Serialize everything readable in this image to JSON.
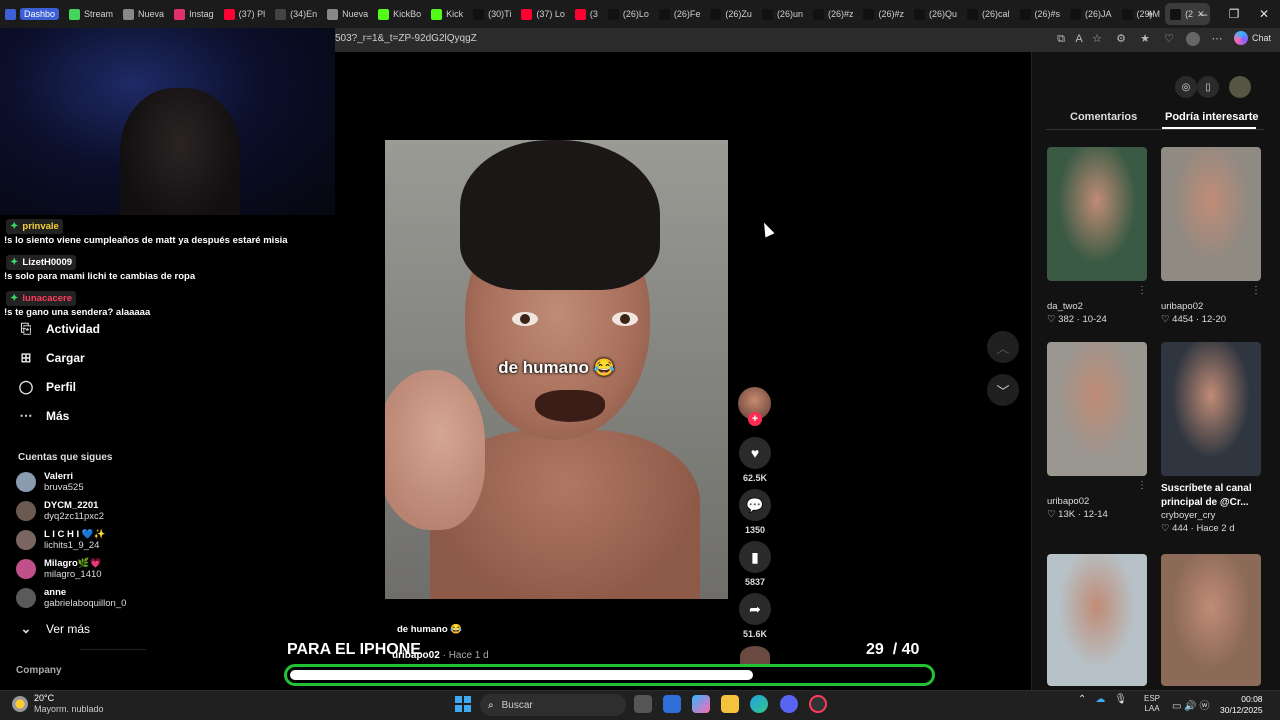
{
  "browser": {
    "tabs": [
      {
        "label": "Dashbo",
        "color": "#3d5fd6",
        "pill": true
      },
      {
        "label": "Stream",
        "color": "#46d35e"
      },
      {
        "label": "Nueva",
        "color": "#888888"
      },
      {
        "label": "Instag",
        "color": "#e1306c"
      },
      {
        "label": "(37) Pl",
        "color": "#ff0033"
      },
      {
        "label": "(34)En",
        "color": "#444444"
      },
      {
        "label": "Nueva",
        "color": "#888888"
      },
      {
        "label": "KickBo",
        "color": "#53fc18"
      },
      {
        "label": "Kick",
        "color": "#53fc18"
      },
      {
        "label": "(30)Ti",
        "color": "#111111"
      },
      {
        "label": "(37) Lo",
        "color": "#ff0033"
      },
      {
        "label": "(3",
        "color": "#ff0033"
      },
      {
        "label": "(26)Lo",
        "color": "#111111"
      },
      {
        "label": "(26)Fe",
        "color": "#111111"
      },
      {
        "label": "(26)Zu",
        "color": "#111111"
      },
      {
        "label": "(26)un",
        "color": "#111111"
      },
      {
        "label": "(26)#z",
        "color": "#111111"
      },
      {
        "label": "(26)#z",
        "color": "#111111"
      },
      {
        "label": "(26)Qu",
        "color": "#111111"
      },
      {
        "label": "(26)cal",
        "color": "#111111"
      },
      {
        "label": "(26)#s",
        "color": "#111111"
      },
      {
        "label": "(26)JA",
        "color": "#111111"
      },
      {
        "label": "(29)M",
        "color": "#111111"
      },
      {
        "label": "(2",
        "color": "#111111",
        "active": true
      }
    ],
    "url": "503?_r=1&_t=ZP-92dG2lQyqgZ",
    "chat_label": "Chat"
  },
  "chat": [
    {
      "user": "prinvale",
      "user_color": "#f5d23a",
      "message": "!s lo siento viene cumpleaños de matt ya después estaré misia"
    },
    {
      "user": "LizetH0009",
      "user_color": "#ffffff",
      "message": "!s solo para mami lichi te cambias de ropa"
    },
    {
      "user": "lunacacere",
      "user_color": "#ff3b5c",
      "message": "!s te gano una sendera? alaaaaa"
    }
  ],
  "nav": [
    {
      "label": "Actividad",
      "icon": "inbox-icon"
    },
    {
      "label": "Cargar",
      "icon": "plus-square-icon"
    },
    {
      "label": "Perfil",
      "icon": "user-icon"
    },
    {
      "label": "Más",
      "icon": "more-icon"
    }
  ],
  "following": {
    "heading": "Cuentas que sigues",
    "accounts": [
      {
        "name": "Valerri",
        "handle": "bruva525",
        "avatar_color": "#8a9bb0"
      },
      {
        "name": "DYCM_2201",
        "handle": "dyq2zc11pxc2",
        "avatar_color": "#6b5a52"
      },
      {
        "name": "L I C H I 💙✨",
        "handle": "lichits1_9_24",
        "avatar_color": "#7a6560"
      },
      {
        "name": "Milagro🌿💗",
        "handle": "milagro_1410",
        "avatar_color": "#c0508a"
      },
      {
        "name": "anne",
        "handle": "gabrielaboquillon_0",
        "avatar_color": "#5a5a5a"
      }
    ],
    "see_more": "Ver más"
  },
  "company_label": "Company",
  "video": {
    "caption": "de humano 😂",
    "description": "de humano 😂",
    "author": "uribapo02",
    "posted": "Hace 1 d",
    "likes": "62.5K",
    "comments": "1350",
    "saves": "5837",
    "shares": "51.6K"
  },
  "stream_overlay": {
    "title": "PARA EL IPHONE",
    "current": "29",
    "goal": "/ 40",
    "progress_fraction": 0.725
  },
  "side_panel": {
    "tab_comments": "Comentarios",
    "tab_interest": "Podría interesarte",
    "items": [
      {
        "user": "da_two2",
        "likes": "♡ 382 · 10-24",
        "thumb_color": "#3a5a44"
      },
      {
        "user": "uribapo02",
        "likes": "♡ 4454 · 12-20",
        "thumb_color": "#8f8a82"
      },
      {
        "user": "uribapo02",
        "likes": "♡ 13K · 12-14",
        "thumb_color": "#9a9690"
      },
      {
        "title": "Suscríbete al canal principal de @Cr...",
        "user": "cryboyer_cry",
        "likes": "♡ 444 · Hace 2 d",
        "thumb_color": "#2f3640"
      },
      {
        "thumb_color": "#b7c2c8"
      },
      {
        "thumb_color": "#8c6a58"
      }
    ]
  },
  "taskbar": {
    "temp": "20°C",
    "weather": "Mayorm. nublado",
    "search": "Buscar",
    "lang_1": "ESP",
    "lang_2": "LAA",
    "time": "00:08",
    "date": "30/12/2025"
  }
}
